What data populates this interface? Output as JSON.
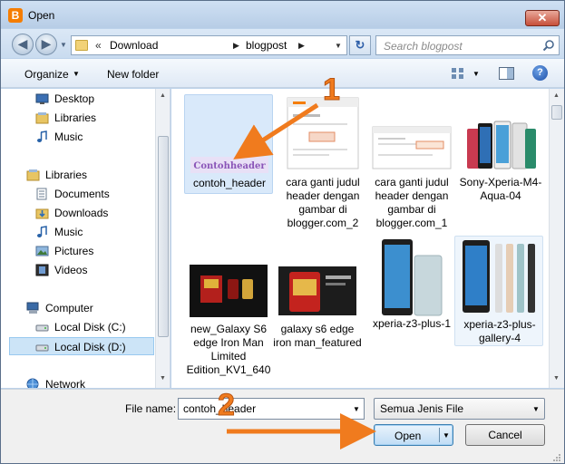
{
  "window": {
    "title": "Open",
    "close_glyph": "✕",
    "app_icon": "blogger-icon"
  },
  "nav": {
    "back_glyph": "◀",
    "forward_glyph": "▶",
    "breadcrumb_prefix": "«",
    "breadcrumbs": [
      "Download",
      "blogpost"
    ],
    "crumb_arrow": "▶",
    "refresh_glyph": "↻",
    "search_placeholder": "Search blogpost"
  },
  "toolbar": {
    "organize_label": "Organize",
    "new_folder_label": "New folder",
    "help_glyph": "?"
  },
  "sidebar": {
    "items": [
      {
        "label": "Desktop",
        "icon": "desktop-icon"
      },
      {
        "label": "Libraries",
        "icon": "libraries-icon"
      },
      {
        "label": "Music",
        "icon": "music-icon"
      },
      {
        "label": "Libraries",
        "icon": "libraries-icon"
      },
      {
        "label": "Documents",
        "icon": "documents-icon"
      },
      {
        "label": "Downloads",
        "icon": "downloads-icon"
      },
      {
        "label": "Music",
        "icon": "music-icon"
      },
      {
        "label": "Pictures",
        "icon": "pictures-icon"
      },
      {
        "label": "Videos",
        "icon": "videos-icon"
      },
      {
        "label": "Computer",
        "icon": "computer-icon"
      },
      {
        "label": "Local Disk (C:)",
        "icon": "drive-icon"
      },
      {
        "label": "Local Disk (D:)",
        "icon": "drive-icon"
      },
      {
        "label": "Network",
        "icon": "network-icon"
      }
    ]
  },
  "files": [
    {
      "name": "contoh_header",
      "thumb_text": "Contohheader"
    },
    {
      "name": "cara ganti judul header dengan gambar di blogger.com_2"
    },
    {
      "name": "cara ganti judul header dengan gambar di blogger.com_1"
    },
    {
      "name": "Sony-Xperia-M4-Aqua-04"
    },
    {
      "name": "new_Galaxy S6 edge Iron Man Limited Edition_KV1_640"
    },
    {
      "name": "galaxy s6 edge iron man_featured"
    },
    {
      "name": "xperia-z3-plus-1"
    },
    {
      "name": "xperia-z3-plus-gallery-4"
    }
  ],
  "footer": {
    "file_name_label": "File name:",
    "file_name_value": "contoh_header",
    "file_type_value": "Semua Jenis File",
    "open_label": "Open",
    "cancel_label": "Cancel"
  },
  "annotations": {
    "step1": "1",
    "step2": "2"
  },
  "colors": {
    "annotation_orange": "#f07b1e",
    "accent_blue": "#3c7fb1"
  }
}
